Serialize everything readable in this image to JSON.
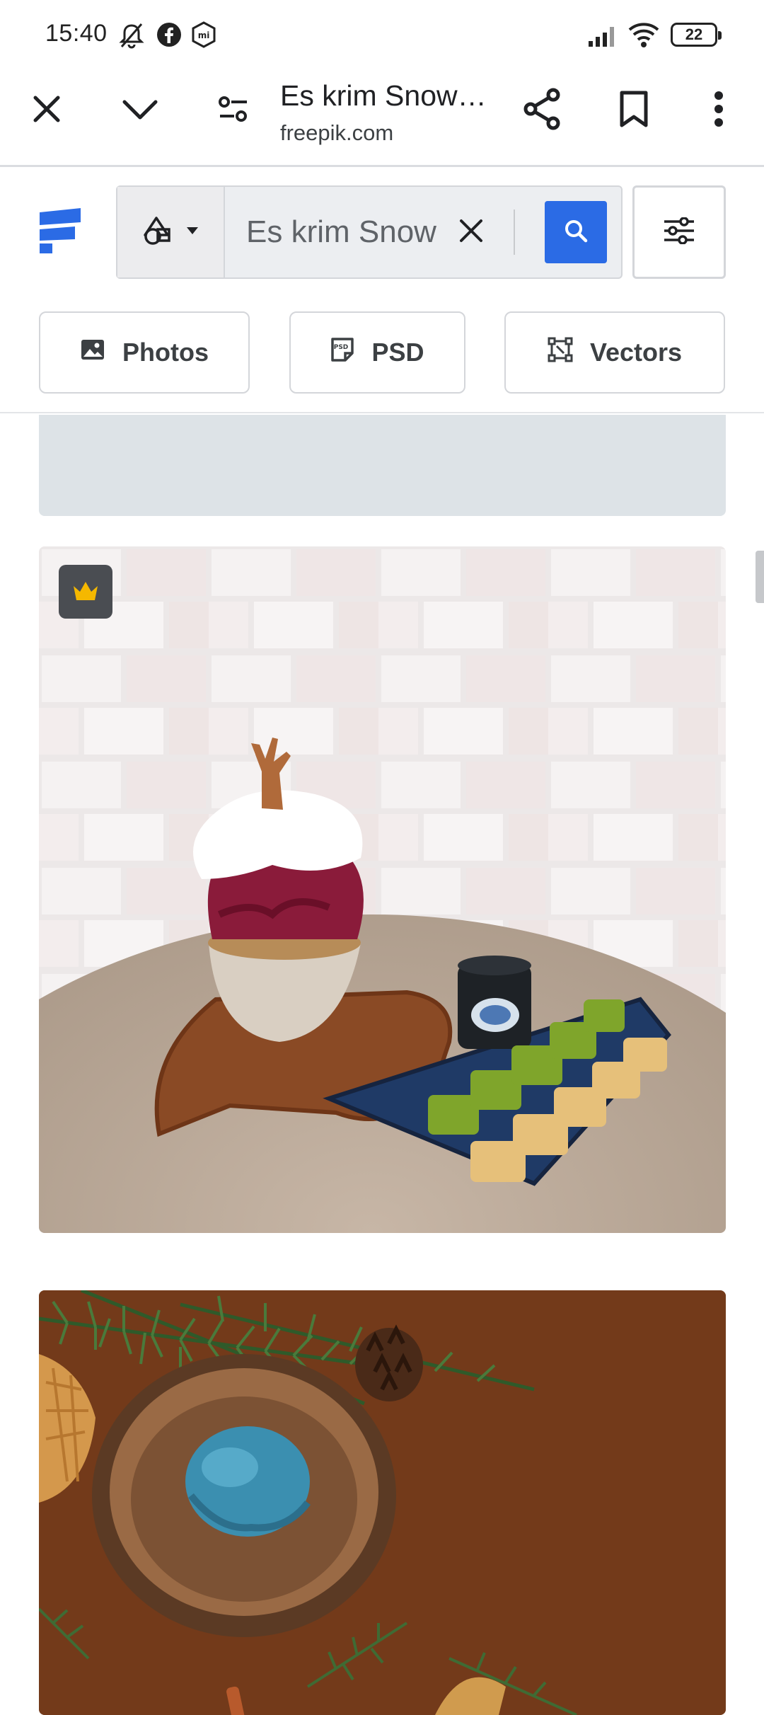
{
  "status_bar": {
    "time": "15:40",
    "icons": [
      "mute-icon",
      "facebook-icon",
      "mi-icon",
      "signal-icon",
      "wifi-icon"
    ],
    "battery": "22"
  },
  "browser": {
    "page_title": "Es krim Snow…",
    "url": "freepik.com",
    "buttons": [
      "close-icon",
      "chevron-down-icon",
      "page-settings-icon",
      "share-icon",
      "bookmark-icon",
      "more-vert-icon"
    ]
  },
  "header": {
    "search": {
      "value": "Es krim Snow",
      "placeholder": "Search"
    },
    "accent_color": "#2b6be5"
  },
  "categories": [
    {
      "label": "Photos",
      "icon": "image-icon"
    },
    {
      "label": "PSD",
      "icon": "psd-icon"
    },
    {
      "label": "Vectors",
      "icon": "vector-icon"
    }
  ],
  "results": [
    {
      "subject": "red bingsu shaved ice with cream and mochi plate",
      "premium": true,
      "premium_color": "#f5b800"
    },
    {
      "subject": "blue ice cream scoop in wooden bowl with pine branches"
    }
  ]
}
